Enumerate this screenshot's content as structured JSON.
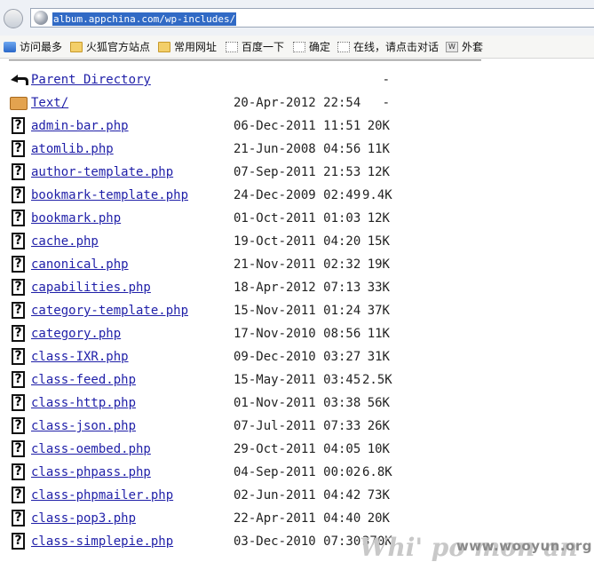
{
  "address_bar": {
    "url": "album.appchina.com/wp-includes/"
  },
  "bookmarks": [
    {
      "label": "访问最多",
      "icon": "blue-page-icon"
    },
    {
      "label": "火狐官方站点",
      "icon": "folder-icon"
    },
    {
      "label": "常用网址",
      "icon": "folder-icon"
    },
    {
      "label": "百度一下",
      "icon": "blank-page-icon"
    },
    {
      "label": "确定",
      "icon": "blank-page-icon"
    },
    {
      "label": "在线，请点击对话",
      "icon": "blank-page-icon"
    },
    {
      "label": "外套",
      "icon": "web-slice-icon"
    }
  ],
  "listing": {
    "parent": {
      "name": "Parent Directory",
      "date": "",
      "size": "-"
    },
    "entries": [
      {
        "name": "Text/",
        "date": "20-Apr-2012 22:54",
        "size": "-",
        "type": "folder"
      },
      {
        "name": "admin-bar.php",
        "date": "06-Dec-2011 11:51",
        "size": "20K",
        "type": "file"
      },
      {
        "name": "atomlib.php",
        "date": "21-Jun-2008 04:56",
        "size": "11K",
        "type": "file"
      },
      {
        "name": "author-template.php",
        "date": "07-Sep-2011 21:53",
        "size": "12K",
        "type": "file"
      },
      {
        "name": "bookmark-template.php",
        "date": "24-Dec-2009 02:49",
        "size": "9.4K",
        "type": "file"
      },
      {
        "name": "bookmark.php",
        "date": "01-Oct-2011 01:03",
        "size": "12K",
        "type": "file"
      },
      {
        "name": "cache.php",
        "date": "19-Oct-2011 04:20",
        "size": "15K",
        "type": "file"
      },
      {
        "name": "canonical.php",
        "date": "21-Nov-2011 02:32",
        "size": "19K",
        "type": "file"
      },
      {
        "name": "capabilities.php",
        "date": "18-Apr-2012 07:13",
        "size": "33K",
        "type": "file"
      },
      {
        "name": "category-template.php",
        "date": "15-Nov-2011 01:24",
        "size": "37K",
        "type": "file"
      },
      {
        "name": "category.php",
        "date": "17-Nov-2010 08:56",
        "size": "11K",
        "type": "file"
      },
      {
        "name": "class-IXR.php",
        "date": "09-Dec-2010 03:27",
        "size": "31K",
        "type": "file"
      },
      {
        "name": "class-feed.php",
        "date": "15-May-2011 03:45",
        "size": "2.5K",
        "type": "file"
      },
      {
        "name": "class-http.php",
        "date": "01-Nov-2011 03:38",
        "size": "56K",
        "type": "file"
      },
      {
        "name": "class-json.php",
        "date": "07-Jul-2011 07:33",
        "size": "26K",
        "type": "file"
      },
      {
        "name": "class-oembed.php",
        "date": "29-Oct-2011 04:05",
        "size": "10K",
        "type": "file"
      },
      {
        "name": "class-phpass.php",
        "date": "04-Sep-2011 00:02",
        "size": "6.8K",
        "type": "file"
      },
      {
        "name": "class-phpmailer.php",
        "date": "02-Jun-2011 04:42",
        "size": "73K",
        "type": "file"
      },
      {
        "name": "class-pop3.php",
        "date": "22-Apr-2011 04:40",
        "size": "20K",
        "type": "file"
      },
      {
        "name": "class-simplepie.php",
        "date": "03-Dec-2010 07:30",
        "size": "370K",
        "type": "file"
      }
    ]
  },
  "watermark": {
    "site": "www.wooyun.org",
    "logo_text": "Whi' po mon an"
  }
}
